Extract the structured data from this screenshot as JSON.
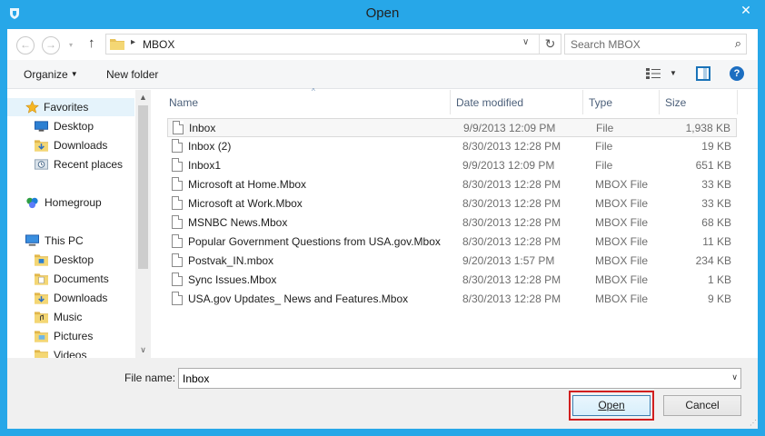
{
  "window": {
    "title": "Open",
    "close_glyph": "✕"
  },
  "nav": {
    "back_glyph": "←",
    "forward_glyph": "→",
    "up_glyph": "↑",
    "breadcrumb": "MBOX",
    "breadcrumb_separator": "▸",
    "dropdown_glyph": "∨",
    "refresh_glyph": "↻"
  },
  "search": {
    "placeholder": "Search MBOX",
    "icon_glyph": "⌕"
  },
  "toolbar": {
    "organize_label": "Organize",
    "new_folder_label": "New folder",
    "help_glyph": "?"
  },
  "sidebar": {
    "items": [
      {
        "label": "Favorites",
        "icon": "star-icon"
      },
      {
        "label": "Desktop",
        "icon": "desktop-icon"
      },
      {
        "label": "Downloads",
        "icon": "downloads-folder-icon"
      },
      {
        "label": "Recent places",
        "icon": "recent-places-icon"
      },
      {
        "label": "Homegroup",
        "icon": "homegroup-icon"
      },
      {
        "label": "This PC",
        "icon": "this-pc-icon"
      },
      {
        "label": "Desktop",
        "icon": "folder-icon"
      },
      {
        "label": "Documents",
        "icon": "folder-icon"
      },
      {
        "label": "Downloads",
        "icon": "folder-icon"
      },
      {
        "label": "Music",
        "icon": "folder-icon"
      },
      {
        "label": "Pictures",
        "icon": "folder-icon"
      },
      {
        "label": "Videos",
        "icon": "folder-icon"
      }
    ],
    "scroll_up_glyph": "▲",
    "scroll_down_glyph": "∨"
  },
  "columns": {
    "name": "Name",
    "date": "Date modified",
    "type": "Type",
    "size": "Size",
    "sort_glyph": "^"
  },
  "files": [
    {
      "name": "Inbox",
      "date": "9/9/2013 12:09 PM",
      "type": "File",
      "size": "1,938 KB"
    },
    {
      "name": "Inbox (2)",
      "date": "8/30/2013 12:28 PM",
      "type": "File",
      "size": "19 KB"
    },
    {
      "name": "Inbox1",
      "date": "9/9/2013 12:09 PM",
      "type": "File",
      "size": "651 KB"
    },
    {
      "name": "Microsoft at Home.Mbox",
      "date": "8/30/2013 12:28 PM",
      "type": "MBOX File",
      "size": "33 KB"
    },
    {
      "name": "Microsoft at Work.Mbox",
      "date": "8/30/2013 12:28 PM",
      "type": "MBOX File",
      "size": "33 KB"
    },
    {
      "name": "MSNBC News.Mbox",
      "date": "8/30/2013 12:28 PM",
      "type": "MBOX File",
      "size": "68 KB"
    },
    {
      "name": "Popular Government Questions from USA.gov.Mbox",
      "date": "8/30/2013 12:28 PM",
      "type": "MBOX File",
      "size": "11 KB"
    },
    {
      "name": "Postvak_IN.mbox",
      "date": "9/20/2013 1:57 PM",
      "type": "MBOX File",
      "size": "234 KB"
    },
    {
      "name": "Sync Issues.Mbox",
      "date": "8/30/2013 12:28 PM",
      "type": "MBOX File",
      "size": "1 KB"
    },
    {
      "name": "USA.gov Updates_ News and Features.Mbox",
      "date": "8/30/2013 12:28 PM",
      "type": "MBOX File",
      "size": "9 KB"
    }
  ],
  "footer": {
    "filename_label": "File name:",
    "filename_value": "Inbox",
    "dropdown_glyph": "∨",
    "open_label": "Open",
    "cancel_label": "Cancel",
    "grip_glyph": "⋰"
  },
  "colors": {
    "title_bar": "#27a7e8",
    "highlight": "#d11f1f",
    "selection": "#e5f3fb"
  }
}
